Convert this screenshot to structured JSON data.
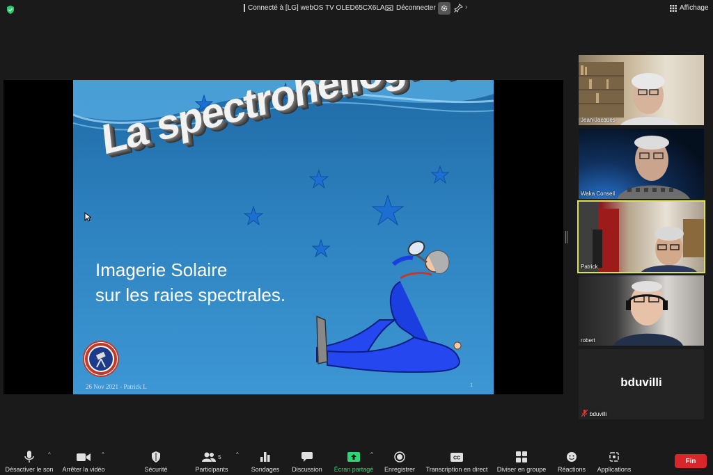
{
  "topbar": {
    "connection_text": "Connecté à [LG] webOS TV OLED65CX6LA",
    "disconnect_label": "Déconnecter",
    "view_label": "Affichage"
  },
  "slide": {
    "title": "La spectrohéliographie",
    "subtitle_line1": "Imagerie Solaire",
    "subtitle_line2": "sur les raies spectrales.",
    "footer_left": "26 Nov 2021 - Patrick L",
    "page_number": "1"
  },
  "participants_panel": [
    {
      "name": "Jean-Jacques",
      "active": false
    },
    {
      "name": "Waka Conseil",
      "active": false
    },
    {
      "name": "Patrick",
      "active": true
    },
    {
      "name": "robert",
      "active": false
    },
    {
      "name": "bduvilli",
      "display_name": "bduvilli",
      "muted": true,
      "video": false
    }
  ],
  "toolbar": {
    "mute_label": "Désactiver le son",
    "video_label": "Arrêter la vidéo",
    "security_label": "Sécurité",
    "participants_label": "Participants",
    "participants_count": "5",
    "polls_label": "Sondages",
    "chat_label": "Discussion",
    "share_label": "Écran partagé",
    "record_label": "Enregistrer",
    "transcription_label": "Transcription en direct",
    "cc_text": "CC",
    "breakout_label": "Diviser en groupe",
    "reactions_label": "Réactions",
    "apps_label": "Applications",
    "end_label": "Fin"
  },
  "colors": {
    "end_red": "#d9262b",
    "share_green": "#2ed573",
    "active_speaker": "#d9e54a"
  }
}
